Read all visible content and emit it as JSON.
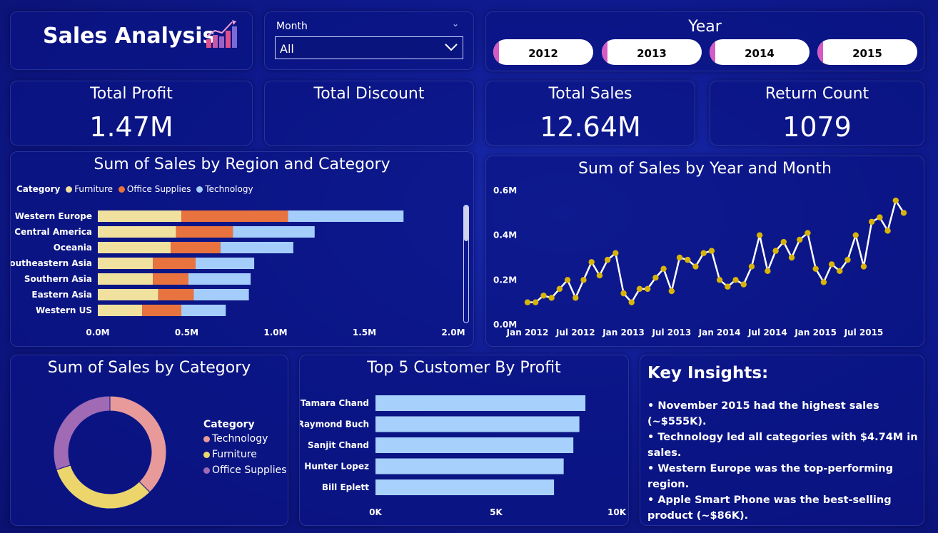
{
  "header": {
    "title": "Sales Analysis"
  },
  "month_slicer": {
    "label": "Month",
    "value": "All"
  },
  "year_slicer": {
    "title": "Year",
    "options": [
      "2012",
      "2013",
      "2014",
      "2015"
    ]
  },
  "kpis": {
    "total_profit": {
      "label": "Total Profit",
      "value": "1.47M"
    },
    "total_discount": {
      "label": "Total Discount",
      "value": ""
    },
    "total_sales": {
      "label": "Total Sales",
      "value": "12.64M"
    },
    "return_count": {
      "label": "Return Count",
      "value": "1079"
    }
  },
  "colors": {
    "furniture": "#f1e19f",
    "office_supplies": "#e8733e",
    "technology": "#a5cdfb",
    "line": "#ffffff",
    "line_marker": "#d8b40a",
    "donut_technology": "#e89a9a",
    "donut_furniture": "#ecd66b",
    "donut_office": "#a06ab4",
    "profit_bar": "#a8d0fc"
  },
  "chart_data": [
    {
      "id": "region",
      "type": "bar",
      "orientation": "horizontal",
      "stacked": true,
      "title": "Sum of Sales by Region and Category",
      "legend_title": "Category",
      "legend_position": "top-left",
      "categories": [
        "Western Europe",
        "Central America",
        "Oceania",
        "Southeastern Asia",
        "Southern Asia",
        "Eastern Asia",
        "Western US"
      ],
      "series": [
        {
          "name": "Furniture",
          "values": [
            0.47,
            0.44,
            0.41,
            0.31,
            0.31,
            0.34,
            0.25
          ]
        },
        {
          "name": "Office Supplies",
          "values": [
            0.6,
            0.32,
            0.28,
            0.24,
            0.2,
            0.2,
            0.22
          ]
        },
        {
          "name": "Technology",
          "values": [
            0.65,
            0.46,
            0.41,
            0.33,
            0.35,
            0.31,
            0.25
          ]
        }
      ],
      "xticks": [
        "0.0M",
        "0.5M",
        "1.0M",
        "1.5M",
        "2.0M"
      ],
      "xlim": [
        0,
        2.0
      ]
    },
    {
      "id": "monthly",
      "type": "line",
      "title": "Sum of Sales by Year and Month",
      "x": [
        "Jan 2012",
        "Feb 2012",
        "Mar 2012",
        "Apr 2012",
        "May 2012",
        "Jun 2012",
        "Jul 2012",
        "Aug 2012",
        "Sep 2012",
        "Oct 2012",
        "Nov 2012",
        "Dec 2012",
        "Jan 2013",
        "Feb 2013",
        "Mar 2013",
        "Apr 2013",
        "May 2013",
        "Jun 2013",
        "Jul 2013",
        "Aug 2013",
        "Sep 2013",
        "Oct 2013",
        "Nov 2013",
        "Dec 2013",
        "Jan 2014",
        "Feb 2014",
        "Mar 2014",
        "Apr 2014",
        "May 2014",
        "Jun 2014",
        "Jul 2014",
        "Aug 2014",
        "Sep 2014",
        "Oct 2014",
        "Nov 2014",
        "Dec 2014",
        "Jan 2015",
        "Feb 2015",
        "Mar 2015",
        "Apr 2015",
        "May 2015",
        "Jun 2015",
        "Jul 2015",
        "Aug 2015",
        "Sep 2015",
        "Oct 2015",
        "Nov 2015",
        "Dec 2015"
      ],
      "values": [
        0.1,
        0.1,
        0.13,
        0.12,
        0.16,
        0.2,
        0.12,
        0.2,
        0.28,
        0.22,
        0.29,
        0.32,
        0.14,
        0.1,
        0.16,
        0.16,
        0.21,
        0.25,
        0.15,
        0.3,
        0.29,
        0.26,
        0.32,
        0.33,
        0.2,
        0.17,
        0.2,
        0.18,
        0.26,
        0.4,
        0.24,
        0.33,
        0.37,
        0.3,
        0.38,
        0.41,
        0.25,
        0.19,
        0.27,
        0.24,
        0.29,
        0.4,
        0.26,
        0.46,
        0.48,
        0.42,
        0.555,
        0.5
      ],
      "xticks": [
        "Jan 2012",
        "Jul 2012",
        "Jan 2013",
        "Jul 2013",
        "Jan 2014",
        "Jul 2014",
        "Jan 2015",
        "Jul 2015"
      ],
      "yticks": [
        "0.0M",
        "0.2M",
        "0.4M",
        "0.6M"
      ],
      "ylim": [
        0,
        0.6
      ]
    },
    {
      "id": "category",
      "type": "pie",
      "donut": true,
      "title": "Sum of Sales by Category",
      "legend_title": "Category",
      "legend_position": "right",
      "categories": [
        "Technology",
        "Furniture",
        "Office Supplies"
      ],
      "values": [
        4.74,
        4.11,
        3.79
      ]
    },
    {
      "id": "customers",
      "type": "bar",
      "orientation": "horizontal",
      "title": "Top 5 Customer By Profit",
      "categories": [
        "Tamara Chand",
        "Raymond Buch",
        "Sanjit Chand",
        "Hunter Lopez",
        "Bill Eplett"
      ],
      "values": [
        8700,
        8450,
        8200,
        7800,
        7400
      ],
      "xticks": [
        "0K",
        "5K",
        "10K"
      ],
      "xlim": [
        0,
        10000
      ]
    }
  ],
  "insights": {
    "title": "Key Insights:",
    "items": [
      "• November 2015 had the highest sales (~$555K).",
      "• Technology led all categories with $4.74M in sales.",
      "• Western Europe was the top-performing region.",
      "• Apple Smart Phone was the best-selling product (~$86K)."
    ]
  }
}
